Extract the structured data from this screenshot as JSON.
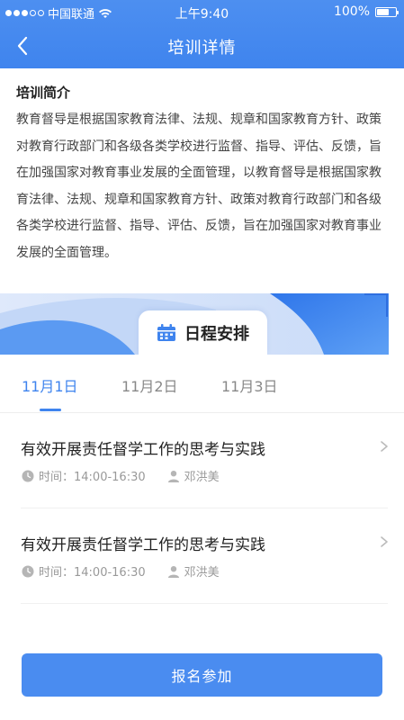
{
  "status_bar": {
    "carrier": "中国联通",
    "time": "上午9:40",
    "battery_percent_text": "100%",
    "battery_level": 0.6,
    "signal_dots_filled": 3,
    "signal_dots_total": 5
  },
  "nav": {
    "title": "培训详情",
    "back_icon": "chevron-left-icon"
  },
  "intro": {
    "title": "培训简介",
    "text": "教育督导是根据国家教育法律、法规、规章和国家教育方针、政策对教育行政部门和各级各类学校进行监督、指导、评估、反馈，旨在加强国家对教育事业发展的全面管理，以教育督导是根据国家教育法律、法规、规章和国家教育方针、政策对教育行政部门和各级各类学校进行监督、指导、评估、反馈，旨在加强国家对教育事业发展的全面管理。"
  },
  "schedule": {
    "title": "日程安排",
    "icon": "calendar-icon",
    "tabs": [
      {
        "label": "11月1日",
        "active": true
      },
      {
        "label": "11月2日",
        "active": false
      },
      {
        "label": "11月3日",
        "active": false
      }
    ],
    "items": [
      {
        "title": "有效开展责任督学工作的思考与实践",
        "time": "时间：14:00-16:30",
        "person": "邓洪美"
      },
      {
        "title": "有效开展责任督学工作的思考与实践",
        "time": "时间：14:00-16:30",
        "person": "邓洪美"
      }
    ]
  },
  "signup": {
    "label": "报名参加"
  },
  "colors": {
    "primary": "#3f84ee",
    "button": "#4a8cf0",
    "banner_light": "#e6eefc",
    "banner_mid": "#b9d2f8",
    "banner_dark": "#3f84ee"
  }
}
